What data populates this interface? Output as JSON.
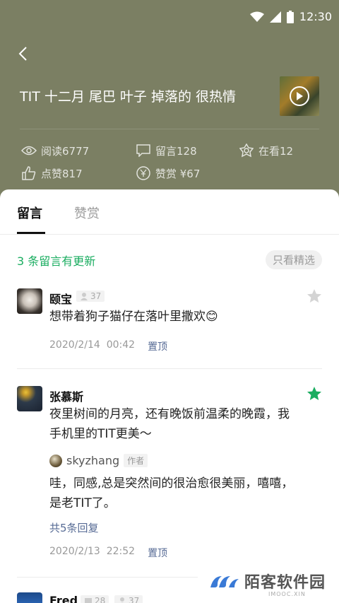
{
  "status_bar": {
    "time": "12:30"
  },
  "article": {
    "title": "TIT 十二月 尾巴 叶子 掉落的 很热情"
  },
  "stats": {
    "read": "阅读6777",
    "comments": "留言128",
    "watching": "在看12",
    "likes": "点赞817",
    "reward": "赞赏 ¥67"
  },
  "tabs": [
    {
      "label": "留言"
    },
    {
      "label": "赞赏"
    }
  ],
  "update_notice": "3 条留言有更新",
  "filter_label": "只看精选",
  "comments": [
    {
      "name": "颐宝",
      "badge": "37",
      "content": "想带着狗子猫仔在落叶里撒欢😊",
      "date": "2020/2/14",
      "time": "00:42",
      "pin": "置顶",
      "starred": false
    },
    {
      "name": "张慕斯",
      "content": "夜里树间的月亮，还有晚饭前温柔的晚霞，我手机里的TIT更美～",
      "reply": {
        "author": "skyzhang",
        "tag": "作者",
        "content": "哇，同感,总是突然间的很治愈很美丽，嘻嘻，是老TIT了。"
      },
      "more_replies": "共5条回复",
      "date": "2020/2/13",
      "time": "22:52",
      "pin": "置顶",
      "starred": true
    },
    {
      "name": "Fred",
      "badge1": "28",
      "badge2": "37"
    }
  ],
  "watermark": {
    "text": "陌客软件园",
    "sub": "IMOOC.XIN"
  },
  "colors": {
    "accent_green": "#1aad60",
    "link_blue": "#576b95",
    "header_bg": "#7b7f63"
  }
}
